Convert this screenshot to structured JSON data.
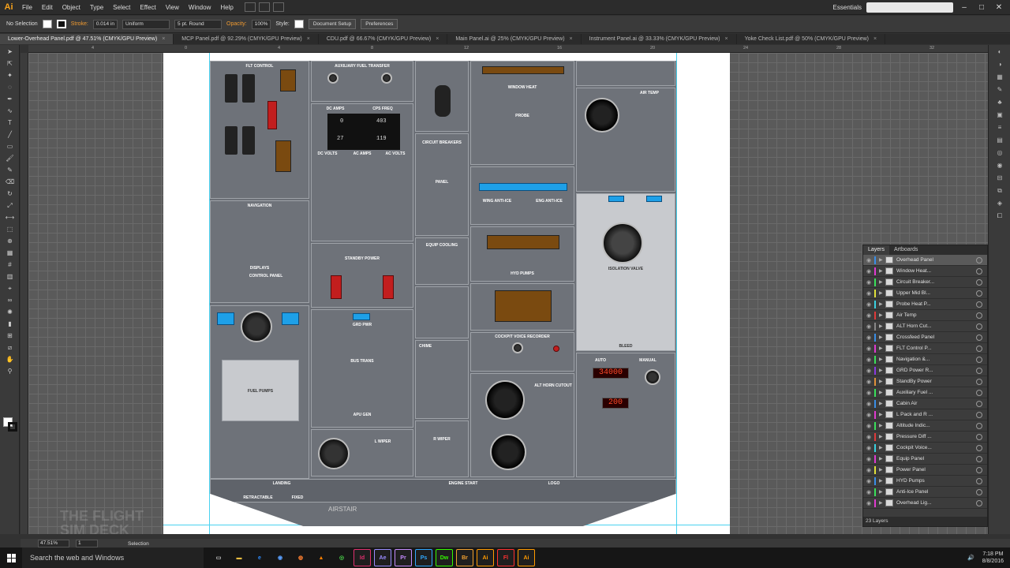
{
  "menubar": {
    "logo": "Ai",
    "items": [
      "File",
      "Edit",
      "Object",
      "Type",
      "Select",
      "Effect",
      "View",
      "Window",
      "Help"
    ],
    "workspace": "Essentials"
  },
  "control": {
    "selection": "No Selection",
    "stroke_label": "Stroke:",
    "stroke_weight": "0.014 in",
    "profile": "Uniform",
    "brush": "5 pt. Round",
    "opacity_label": "Opacity:",
    "opacity": "100%",
    "style_label": "Style:",
    "doc_setup": "Document Setup",
    "preferences": "Preferences"
  },
  "tabs": [
    {
      "label": "Lower-Overhead Panel.pdf @ 47.51% (CMYK/GPU Preview)",
      "active": true
    },
    {
      "label": "MCP Panel.pdf @ 92.29% (CMYK/GPU Preview)"
    },
    {
      "label": "CDU.pdf @ 66.67% (CMYK/GPU Preview)"
    },
    {
      "label": "Main Panel.ai @ 25% (CMYK/GPU Preview)"
    },
    {
      "label": "Instrument Panel.ai @ 33.33% (CMYK/GPU Preview)"
    },
    {
      "label": "Yoke Check List.pdf @ 50% (CMYK/GPU Preview)"
    }
  ],
  "rulers": {
    "h": [
      "4",
      "0",
      "4",
      "8",
      "12",
      "16",
      "20",
      "24",
      "28",
      "32"
    ]
  },
  "panel": {
    "fuel_label": "FUEL PUMPS",
    "fuel_control": "FLT CONTROL",
    "aux_fuel": "AUXILIARY FUEL TRANSFER",
    "circuit": "CIRCUIT BREAKERS",
    "panel_lbl": "PANEL",
    "window_heat": "WINDOW HEAT",
    "probe": "PROBE",
    "air_temp": "AIR TEMP",
    "navigation": "NAVIGATION",
    "displays": "DISPLAYS",
    "control_panel": "CONTROL PANEL",
    "dc_amps": "DC AMPS",
    "cps_freq": "CPS FREQ",
    "disp_a": "0",
    "disp_b": "403",
    "disp_c": "27",
    "disp_d": "119",
    "dc_volts": "DC VOLTS",
    "ac_amps": "AC AMPS",
    "ac_volts": "AC VOLTS",
    "equip_cooling": "EQUIP  COOLING",
    "standby_power": "STANDBY POWER",
    "grd_pwr": "GRD PWR",
    "bus_trans": "BUS TRANS",
    "apu_gen": "APU GEN",
    "chime": "CHIME",
    "wing_anti_ice": "WING ANTI-ICE",
    "eng_anti_ice": "ENG ANTI-ICE",
    "hyd_pumps": "HYD PUMPS",
    "cockpit_voice": "COCKPIT VOICE RECORDER",
    "alt_horn": "ALT HORN CUTOUT",
    "isolation_valve": "ISOLATION VALVE",
    "bleed": "BLEED",
    "auto": "AUTO",
    "manual": "MANUAL",
    "flt_alt": "34000",
    "land_alt": "200",
    "landing": "LANDING",
    "retractable": "RETRACTABLE",
    "fixed": "FIXED",
    "engine_start": "ENGINE START",
    "logo": "LOGO",
    "l_wiper": "L WIPER",
    "r_wiper": "R WIPER",
    "airstair": "AIRSTAIR"
  },
  "layers": {
    "tabs": [
      "Layers",
      "Artboards"
    ],
    "items": [
      {
        "name": "Overhead Panel",
        "color": "#3a8ee6",
        "sel": true
      },
      {
        "name": "Window Heat...",
        "color": "#e03ad0"
      },
      {
        "name": "Circuit Breaker...",
        "color": "#3ae05a"
      },
      {
        "name": "Upper Mid Bl...",
        "color": "#e0e03a"
      },
      {
        "name": "Probe Heat P...",
        "color": "#3ad0e0"
      },
      {
        "name": "Air Temp",
        "color": "#e03a3a"
      },
      {
        "name": "ALT Horn Cut...",
        "color": "#888888"
      },
      {
        "name": "Crossfeed Panel",
        "color": "#3a8ee6"
      },
      {
        "name": "FLT Control P...",
        "color": "#e03ad0"
      },
      {
        "name": "Navigation &...",
        "color": "#3ae05a"
      },
      {
        "name": "GRD Power R...",
        "color": "#8a3ae0"
      },
      {
        "name": "StandBy Power",
        "color": "#e0903a"
      },
      {
        "name": "Auxiliary Fuel ...",
        "color": "#3ae05a"
      },
      {
        "name": "Cabin Air",
        "color": "#3a8ee6"
      },
      {
        "name": "L Pack and R ...",
        "color": "#e03ad0"
      },
      {
        "name": "Altitude Indic...",
        "color": "#3ae05a"
      },
      {
        "name": "Pressure Diff ...",
        "color": "#e03a3a"
      },
      {
        "name": "Cockpit Voice...",
        "color": "#3ad0e0"
      },
      {
        "name": "Equip Panel",
        "color": "#e03ad0"
      },
      {
        "name": "Power Panel",
        "color": "#e0e03a"
      },
      {
        "name": "HYD Pumps",
        "color": "#3a8ee6"
      },
      {
        "name": "Anti-Ice Panel",
        "color": "#3ae05a"
      },
      {
        "name": "Overhead Lig...",
        "color": "#e03ad0"
      }
    ],
    "count": "23 Layers"
  },
  "status": {
    "zoom": "47.51%",
    "artboard": "1",
    "mode": "Selection"
  },
  "taskbar": {
    "search": "Search the web and Windows",
    "apps": [
      {
        "t": "Id",
        "c": "#e0306e"
      },
      {
        "t": "Ae",
        "c": "#9a8cff"
      },
      {
        "t": "Pr",
        "c": "#c58cff"
      },
      {
        "t": "Ps",
        "c": "#31a8ff"
      },
      {
        "t": "Dw",
        "c": "#35fa00"
      },
      {
        "t": "Br",
        "c": "#f0a030"
      },
      {
        "t": "Ai",
        "c": "#ff9a00"
      },
      {
        "t": "Fl",
        "c": "#ff3030"
      },
      {
        "t": "Ai",
        "c": "#ff9a00"
      }
    ],
    "time": "7:18 PM",
    "date": "8/8/2016"
  }
}
